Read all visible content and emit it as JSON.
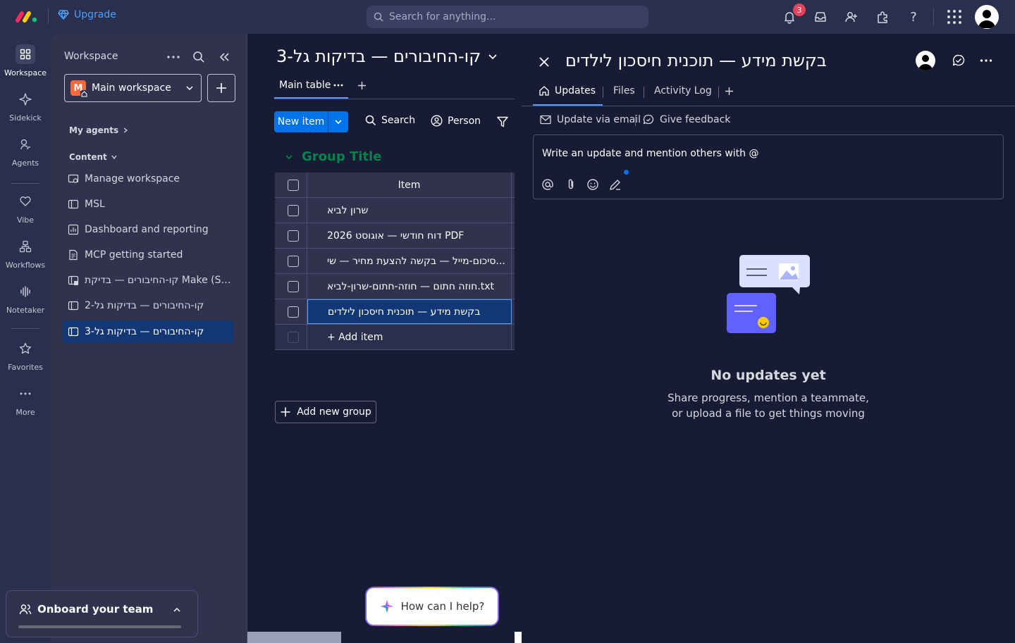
{
  "topbar": {
    "upgrade_label": "Upgrade",
    "search_placeholder": "Search for anything...",
    "notification_count": "3"
  },
  "rail": {
    "items": [
      {
        "label": "Workspace"
      },
      {
        "label": "Sidekick"
      },
      {
        "label": "Agents"
      },
      {
        "label": "Vibe"
      },
      {
        "label": "Workflows"
      },
      {
        "label": "Notetaker"
      },
      {
        "label": "Favorites"
      },
      {
        "label": "More"
      }
    ]
  },
  "workspace": {
    "title": "Workspace",
    "selected": "Main workspace",
    "badge_letter": "M",
    "my_agents": "My agents",
    "content": "Content",
    "items": [
      {
        "label": "Manage workspace"
      },
      {
        "label": "MSL"
      },
      {
        "label": "Dashboard and reporting"
      },
      {
        "label": "MCP getting started"
      },
      {
        "label": "קו-החיבורים — בדיקת Make (Sh..."
      },
      {
        "label": "קו-החיבורים — בדיקות גל-2"
      },
      {
        "label": "קו-החיבורים — בדיקות גל-3"
      }
    ],
    "onboard": "Onboard your team"
  },
  "board": {
    "title": "קו-החיבורים — בדיקות גל-3",
    "tab_main": "Main table",
    "new_item": "New item",
    "search": "Search",
    "person": "Person",
    "group_title": "Group Title",
    "column_item": "Item",
    "rows": [
      {
        "name": "שרון לביא"
      },
      {
        "name": "דוח חודשי — אוגוסט 2026 PDF"
      },
      {
        "name": "סיכום-מייל — בקשה להצעת מחיר — שי..."
      },
      {
        "name": "חוזה חתום — חוזה-חתום-שרון-לביא.txt"
      },
      {
        "name": "בקשת מידע — תוכנית חיסכון לילדים"
      }
    ],
    "add_item": "+ Add item",
    "add_group": "Add new group",
    "helper": "How can I help?"
  },
  "panel": {
    "title": "בקשת מידע — תוכנית חיסכון לילדים",
    "tabs": [
      {
        "label": "Updates"
      },
      {
        "label": "Files"
      },
      {
        "label": "Activity Log"
      }
    ],
    "update_via_email": "Update via email",
    "give_feedback": "Give feedback",
    "composer_placeholder": "Write an update and mention others with @",
    "empty_title": "No updates yet",
    "empty_line1": "Share progress, mention a teammate,",
    "empty_line2": "or upload a file to get things moving"
  },
  "colors": {
    "accent": "#0073ea",
    "group": "#00854d",
    "background": "#181b34",
    "surface": "#30324e"
  }
}
